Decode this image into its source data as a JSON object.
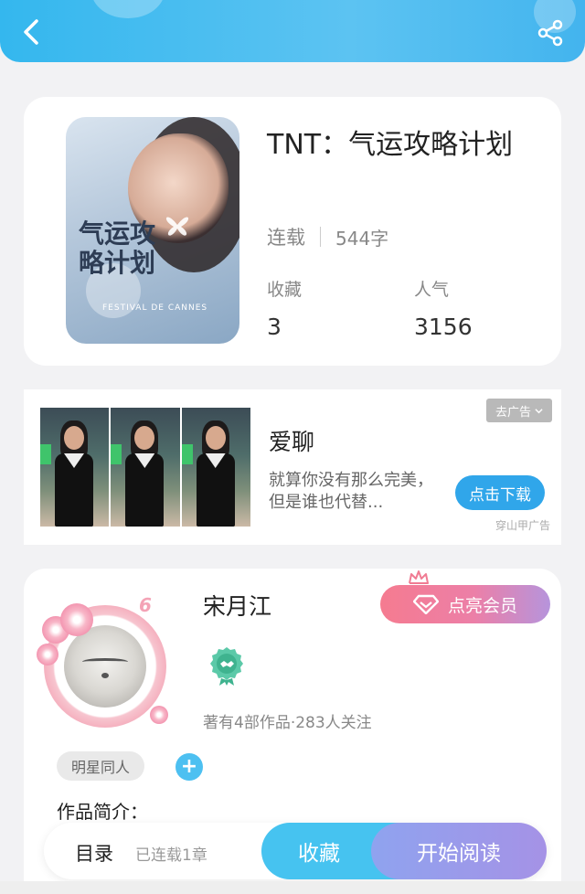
{
  "header": {
    "back_icon": "chevron-left-icon",
    "share_icon": "share-icon"
  },
  "book": {
    "title": "TNT：气运攻略计划",
    "status": "连载",
    "word_count": "544字",
    "collect_label": "收藏",
    "collect_count": "3",
    "popularity_label": "人气",
    "popularity_count": "3156",
    "cover_art_text": "气运攻略计划",
    "cover_festival_text": "FESTIVAL DE CANNES"
  },
  "ad": {
    "close_label": "去广告",
    "app_name": "爱聊",
    "description": "就算你没有那么完美，但是谁也代替...",
    "download_label": "点击下载",
    "source": "穿山甲广告"
  },
  "author": {
    "name": "宋月江",
    "level": "6",
    "vip_label": "点亮会员",
    "stats": "著有4部作品·283人关注",
    "tag": "明星同人",
    "add_tag": "+",
    "intro_title": "作品简介："
  },
  "bottom_bar": {
    "toc_label": "目录",
    "chapters": "已连载1章",
    "collect_button": "收藏",
    "read_button": "开始阅读"
  },
  "colors": {
    "accent": "#34b7ee",
    "vip_start": "#f57b90",
    "vip_end": "#b694dc",
    "read_button": "#a592e6"
  }
}
